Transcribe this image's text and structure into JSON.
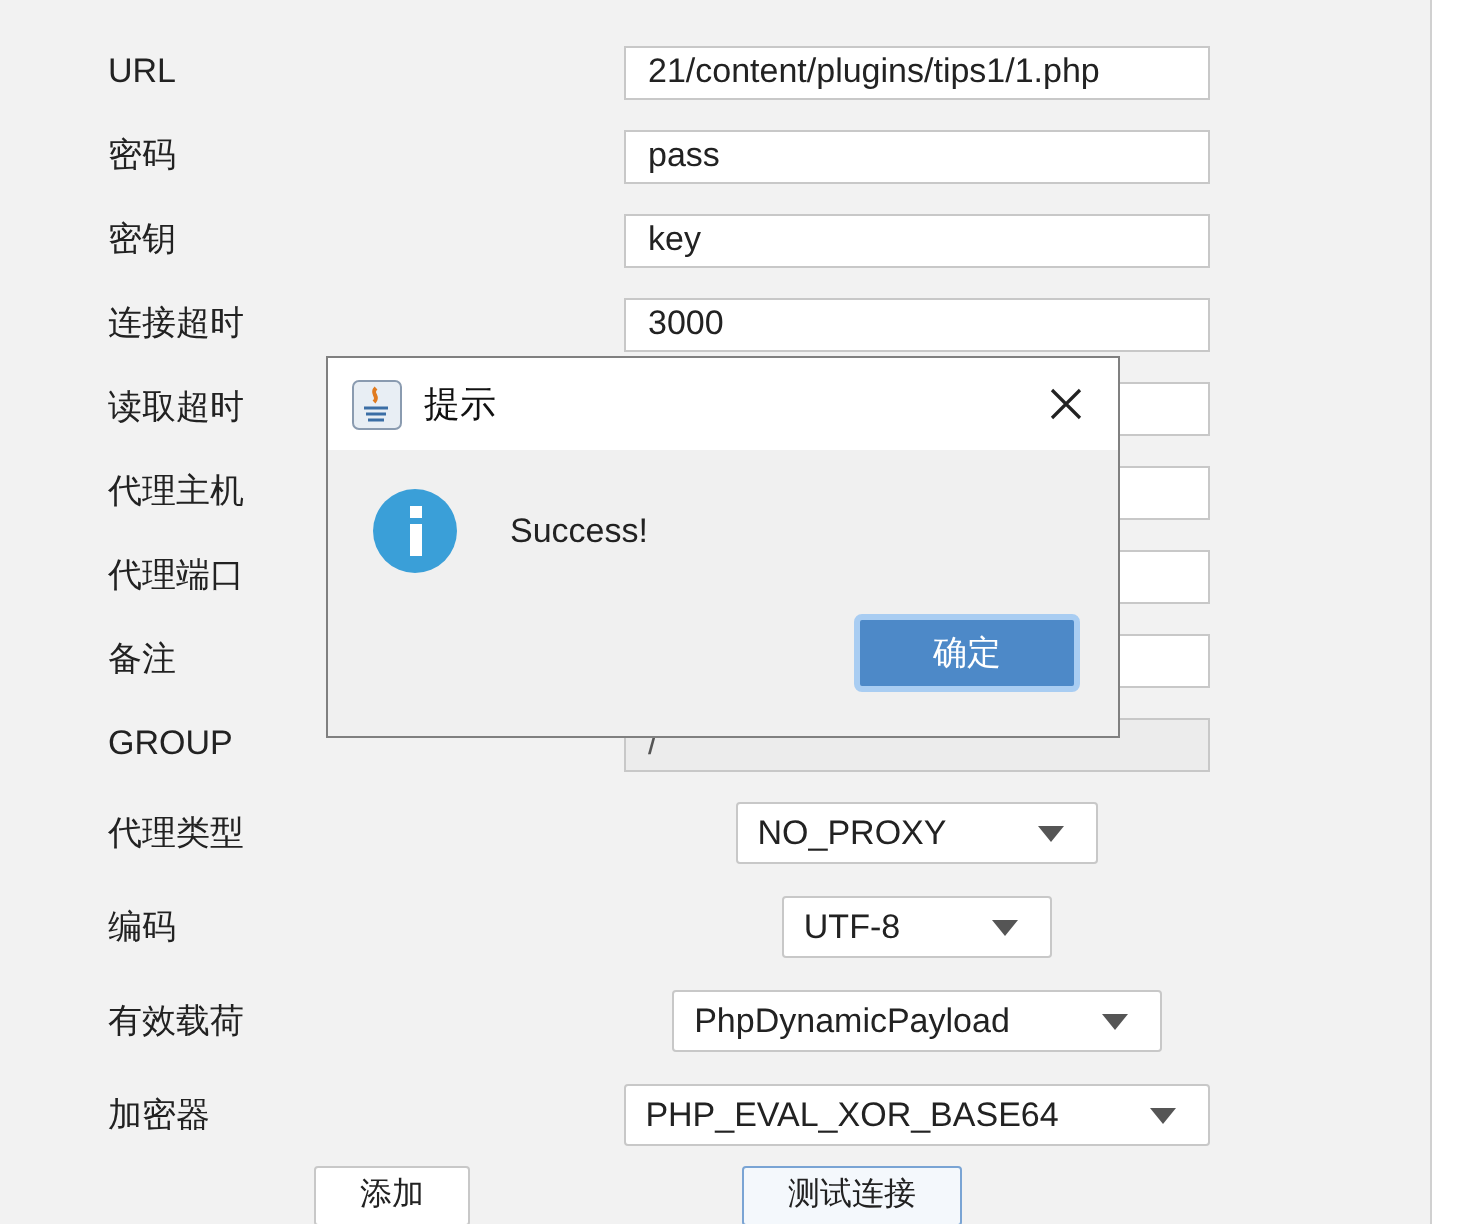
{
  "fields": [
    {
      "label": "URL",
      "value": "21/content/plugins/tips1/1.php",
      "disabled": false
    },
    {
      "label": "密码",
      "value": "pass",
      "disabled": false
    },
    {
      "label": "密钥",
      "value": "key",
      "disabled": false
    },
    {
      "label": "连接超时",
      "value": "3000",
      "disabled": false
    },
    {
      "label": "读取超时",
      "disabled": false
    },
    {
      "label": "代理主机",
      "disabled": false
    },
    {
      "label": "代理端口",
      "disabled": false
    },
    {
      "label": "备注",
      "disabled": false
    },
    {
      "label": "GROUP",
      "value": "/",
      "disabled": true
    }
  ],
  "selects": [
    {
      "label": "代理类型",
      "value": "NO_PROXY"
    },
    {
      "label": "编码",
      "value": "UTF-8"
    },
    {
      "label": "有效载荷",
      "value": "PhpDynamicPayload"
    },
    {
      "label": "加密器",
      "value": "PHP_EVAL_XOR_BASE64"
    }
  ],
  "buttons": [
    {
      "label": "添加",
      "focused": false
    },
    {
      "label": "测试连接",
      "focused": true
    }
  ],
  "dialog": {
    "title": "提示",
    "message": "Success!",
    "button": "确定"
  }
}
